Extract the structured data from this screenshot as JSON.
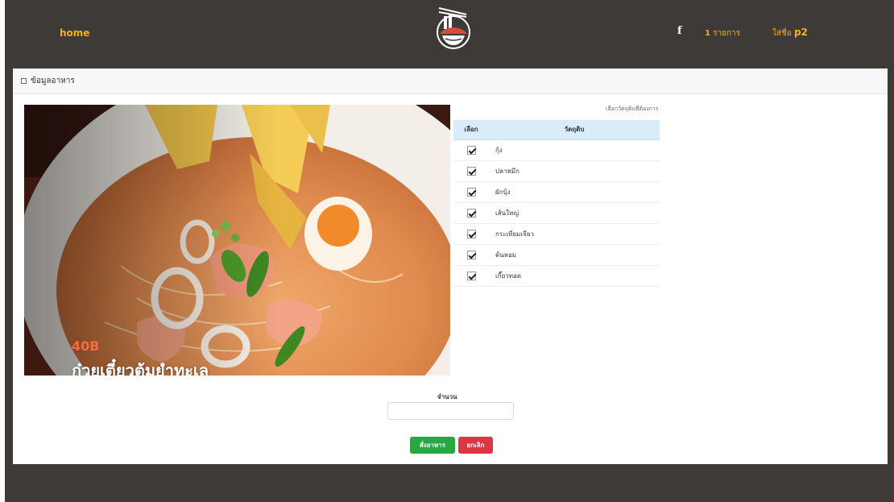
{
  "nav": {
    "home": "home",
    "facebook": "f",
    "cart_count": "1",
    "cart_label": "รายการ",
    "user_prefix": "ใส่ชื่อ",
    "user_name": "p2"
  },
  "card": {
    "header_title": "ข้อมูลอาหาร"
  },
  "food": {
    "price": "40B",
    "name": "ก๋วยเตี๋ยวต้มยำทะเล"
  },
  "ingredients": {
    "title": "เลือกวัตถุดิบที่ต้องการ",
    "col_select": "เลือก",
    "col_name": "วัตถุดิบ",
    "items": [
      {
        "name": "กุ้ง",
        "checked": true
      },
      {
        "name": "ปลาหมึก",
        "checked": true
      },
      {
        "name": "ผักบุ้ง",
        "checked": true
      },
      {
        "name": "เส้นใหญ่",
        "checked": true
      },
      {
        "name": "กระเทียมเจียว",
        "checked": true
      },
      {
        "name": "ต้นหอม",
        "checked": true
      },
      {
        "name": "เกี๊ยวทอด",
        "checked": true
      }
    ]
  },
  "order": {
    "qty_label": "จำนวน",
    "qty_value": "",
    "order_button": "สั่งอาหาร",
    "cancel_button": "ยกเลิก"
  },
  "colors": {
    "nav_bg": "#3d3a38",
    "accent": "#f2b21c",
    "price": "#ff6a3d",
    "order_green": "#28a745",
    "cancel_red": "#dc3545",
    "table_header": "#d8ecf9"
  }
}
